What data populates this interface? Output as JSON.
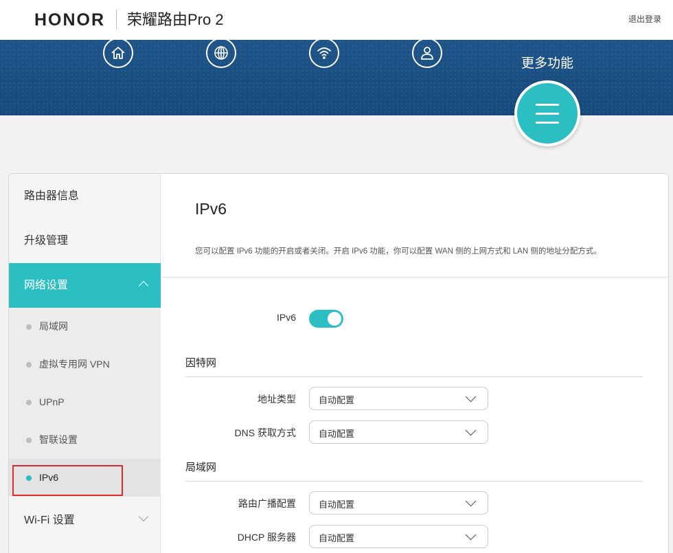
{
  "header": {
    "brand": "HONOR",
    "product": "荣耀路由Pro 2",
    "logout": "退出登录"
  },
  "nav": {
    "items": [
      {
        "label": "主页",
        "icon": "home-icon"
      },
      {
        "label": "我要上网",
        "icon": "globe-icon"
      },
      {
        "label": "我的 Wi-Fi",
        "icon": "wifi-icon"
      },
      {
        "label": "终端管理",
        "icon": "user-icon"
      }
    ],
    "more": {
      "label": "更多功能",
      "icon": "menu-icon"
    }
  },
  "sidebar": {
    "items": [
      {
        "label": "路由器信息"
      },
      {
        "label": "升级管理"
      },
      {
        "label": "网络设置",
        "active": true,
        "expanded": true
      },
      {
        "label": "Wi-Fi 设置",
        "expanded": false
      }
    ],
    "subitems": [
      {
        "label": "局域网"
      },
      {
        "label": "虚拟专用网 VPN"
      },
      {
        "label": "UPnP"
      },
      {
        "label": "智联设置"
      },
      {
        "label": "IPv6",
        "selected": true
      }
    ]
  },
  "content": {
    "title": "IPv6",
    "description": "您可以配置 IPv6 功能的开启或者关闭。开启 IPv6 功能，你可以配置 WAN 侧的上网方式和 LAN 侧的地址分配方式。",
    "ipv6_toggle": {
      "label": "IPv6",
      "enabled": true
    },
    "sections": [
      {
        "title": "因特网",
        "fields": [
          {
            "label": "地址类型",
            "value": "自动配置"
          },
          {
            "label": "DNS 获取方式",
            "value": "自动配置"
          }
        ]
      },
      {
        "title": "局域网",
        "fields": [
          {
            "label": "路由广播配置",
            "value": "自动配置"
          },
          {
            "label": "DHCP 服务器",
            "value": "自动配置"
          }
        ]
      }
    ]
  },
  "colors": {
    "accent": "#2bbfc3",
    "nav_bg": "#1b4f83",
    "highlight": "#e02a2a"
  }
}
